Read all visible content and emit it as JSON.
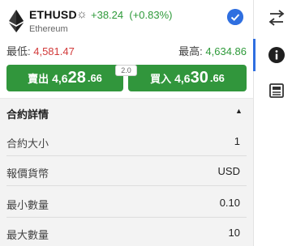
{
  "header": {
    "symbol": "ETHUSD",
    "change": "+38.24",
    "change_pct": "(+0.83%)",
    "name": "Ethereum",
    "icons": {
      "logo": "ethereum-logo-icon",
      "session": "sun-icon",
      "verified": "verified-check-icon"
    }
  },
  "range": {
    "low_label": "最低: ",
    "low_value": "4,581.47",
    "high_label": "最高: ",
    "high_value": "4,634.86"
  },
  "trade": {
    "sell_label": "賣出",
    "sell_price_a": "4,6",
    "sell_price_b": "28",
    "sell_price_c": ".66",
    "buy_label": "買入",
    "buy_price_a": "4,6",
    "buy_price_b": "30",
    "buy_price_c": ".66",
    "spread": "2.0"
  },
  "details": {
    "title": "合約詳情",
    "rows": [
      {
        "label": "合約大小",
        "value": "1"
      },
      {
        "label": "報價貨幣",
        "value": "USD"
      },
      {
        "label": "最小數量",
        "value": "0.10"
      },
      {
        "label": "最大數量",
        "value": "10"
      }
    ]
  },
  "rail": {
    "icons": [
      "swap-arrows-icon",
      "info-icon",
      "newspaper-icon"
    ]
  },
  "colors": {
    "up": "#2e9a3a",
    "down": "#d23a3a",
    "button": "#31963c",
    "accent": "#2f6fe0"
  }
}
